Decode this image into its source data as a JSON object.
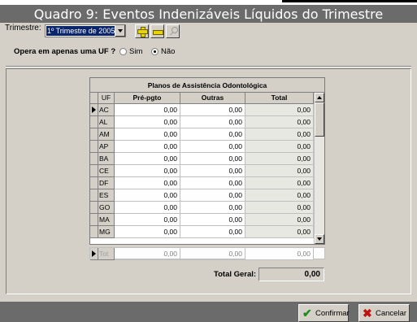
{
  "window": {
    "title": "Quadro 9: Eventos Indenizáveis Líquidos do Trimestre"
  },
  "filter": {
    "trimestre_label": "Trimestre:",
    "trimestre_value": "1º Trimestre de 2005"
  },
  "toolbar": {
    "add_icon": "plus-icon",
    "remove_icon": "minus-icon",
    "search_icon": "search-icon"
  },
  "uf_option": {
    "question": "Opera em apenas uma UF ?",
    "sim_label": "Sim",
    "nao_label": "Não",
    "selected": "Não"
  },
  "grid": {
    "title": "Planos de Assistência Odontológica",
    "columns": [
      "UF",
      "Pré-pgto",
      "Outras",
      "Total"
    ],
    "rows": [
      {
        "uf": "AC",
        "pre": "0,00",
        "outras": "0,00",
        "total": "0,00"
      },
      {
        "uf": "AL",
        "pre": "0,00",
        "outras": "0,00",
        "total": "0,00"
      },
      {
        "uf": "AM",
        "pre": "0,00",
        "outras": "0,00",
        "total": "0,00"
      },
      {
        "uf": "AP",
        "pre": "0,00",
        "outras": "0,00",
        "total": "0,00"
      },
      {
        "uf": "BA",
        "pre": "0,00",
        "outras": "0,00",
        "total": "0,00"
      },
      {
        "uf": "CE",
        "pre": "0,00",
        "outras": "0,00",
        "total": "0,00"
      },
      {
        "uf": "DF",
        "pre": "0,00",
        "outras": "0,00",
        "total": "0,00"
      },
      {
        "uf": "ES",
        "pre": "0,00",
        "outras": "0,00",
        "total": "0,00"
      },
      {
        "uf": "GO",
        "pre": "0,00",
        "outras": "0,00",
        "total": "0,00"
      },
      {
        "uf": "MA",
        "pre": "0,00",
        "outras": "0,00",
        "total": "0,00"
      },
      {
        "uf": "MG",
        "pre": "0,00",
        "outras": "0,00",
        "total": "0,00"
      }
    ],
    "total_row": {
      "uf": "Tot",
      "pre": "0,00",
      "outras": "0,00",
      "total": "0,00"
    }
  },
  "total_geral": {
    "label": "Total Geral:",
    "value": "0,00"
  },
  "actions": {
    "confirm_label": "Confirmar",
    "cancel_label": "Cancelar"
  },
  "colors": {
    "titlebar": "#6b6b6b",
    "selection": "#0a246a",
    "face": "#d4d0c8",
    "confirm_icon": "#1e8a1e",
    "cancel_icon": "#c01010"
  }
}
